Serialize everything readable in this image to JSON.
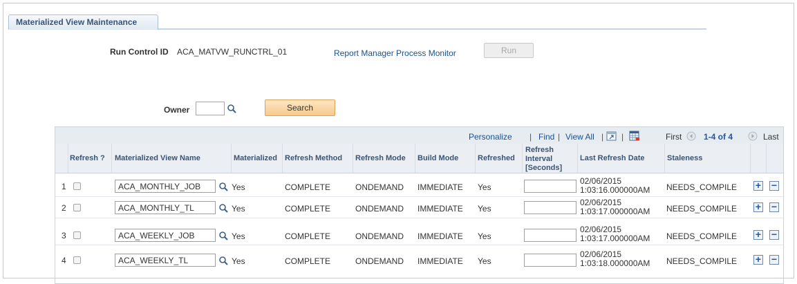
{
  "tab": {
    "label": "Materialized View Maintenance"
  },
  "run_control": {
    "label": "Run Control ID",
    "value": "ACA_MATVW_RUNCTRL_01",
    "link": "Report Manager Process Monitor",
    "run_button": "Run"
  },
  "search": {
    "owner_label": "Owner",
    "owner_value": "",
    "button": "Search"
  },
  "grid": {
    "toolbar": {
      "personalize": "Personalize",
      "find": "Find",
      "view_all": "View All",
      "first": "First",
      "range": "1-4 of 4",
      "last": "Last"
    },
    "columns": {
      "refresh": "Refresh ?",
      "name": "Materialized View Name",
      "materialized": "Materialized",
      "method": "Refresh Method",
      "mode": "Refresh Mode",
      "build": "Build Mode",
      "refreshed": "Refreshed",
      "interval_1": "Refresh",
      "interval_2": "Interval",
      "interval_3": "[Seconds]",
      "last_date": "Last Refresh Date",
      "staleness": "Staleness"
    },
    "rows": [
      {
        "num": "1",
        "name": "ACA_MONTHLY_JOB",
        "materialized": "Yes",
        "method": "COMPLETE",
        "mode": "ONDEMAND",
        "build": "IMMEDIATE",
        "refreshed": "Yes",
        "interval": "",
        "date_1": "02/06/2015",
        "date_2": "1:03:16.000000AM",
        "staleness": "NEEDS_COMPILE"
      },
      {
        "num": "2",
        "name": "ACA_MONTHLY_TL",
        "materialized": "Yes",
        "method": "COMPLETE",
        "mode": "ONDEMAND",
        "build": "IMMEDIATE",
        "refreshed": "Yes",
        "interval": "",
        "date_1": "02/06/2015",
        "date_2": "1:03:17.000000AM",
        "staleness": "NEEDS_COMPILE"
      },
      {
        "num": "3",
        "name": "ACA_WEEKLY_JOB",
        "materialized": "Yes",
        "method": "COMPLETE",
        "mode": "ONDEMAND",
        "build": "IMMEDIATE",
        "refreshed": "Yes",
        "interval": "",
        "date_1": "02/06/2015",
        "date_2": "1:03:17.000000AM",
        "staleness": "NEEDS_COMPILE"
      },
      {
        "num": "4",
        "name": "ACA_WEEKLY_TL",
        "materialized": "Yes",
        "method": "COMPLETE",
        "mode": "ONDEMAND",
        "build": "IMMEDIATE",
        "refreshed": "Yes",
        "interval": "",
        "date_1": "02/06/2015",
        "date_2": "1:03:18.000000AM",
        "staleness": "NEEDS_COMPILE"
      }
    ],
    "add_symbol": "+",
    "delete_symbol": "−"
  },
  "icons": {
    "lookup": "magnifier-icon",
    "zoom": "zoom-icon",
    "download": "spreadsheet-download-icon",
    "first": "first-arrow-icon",
    "last": "last-arrow-icon"
  },
  "colors": {
    "link": "#1b4f8f",
    "header_text": "#3a5475",
    "search_button": "#f8c98a"
  }
}
